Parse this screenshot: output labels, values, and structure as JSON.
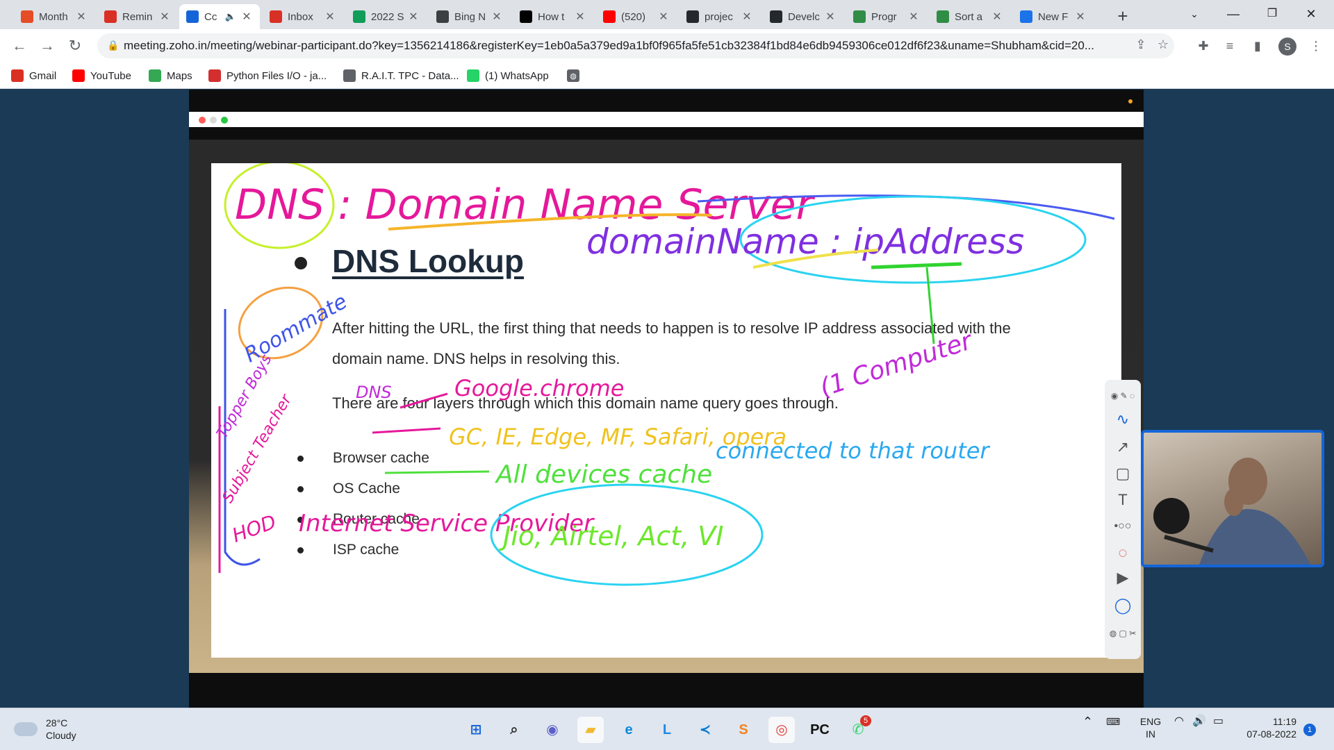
{
  "browser": {
    "tabs": [
      {
        "title": "Month",
        "favicon": "zoho-icon",
        "color": "#e44d26",
        "active": false
      },
      {
        "title": "Remin",
        "favicon": "gmail-icon",
        "color": "#d93025",
        "active": false
      },
      {
        "title": "Cc",
        "favicon": "zoho-meeting-icon",
        "color": "#1565d8",
        "active": true,
        "audio": true
      },
      {
        "title": "Inbox",
        "favicon": "gmail-icon",
        "color": "#d93025",
        "active": false
      },
      {
        "title": "2022 S",
        "favicon": "sheets-icon",
        "color": "#0f9d58",
        "active": false
      },
      {
        "title": "Bing N",
        "favicon": "bing-icon",
        "color": "#3c4043",
        "active": false
      },
      {
        "title": "How t",
        "favicon": "rakuten-icon",
        "color": "#000000",
        "active": false
      },
      {
        "title": "(520)",
        "favicon": "youtube-icon",
        "color": "#ff0000",
        "active": false
      },
      {
        "title": "projec",
        "favicon": "github-icon",
        "color": "#24292e",
        "active": false
      },
      {
        "title": "Develc",
        "favicon": "github-icon",
        "color": "#24292e",
        "active": false
      },
      {
        "title": "Progr",
        "favicon": "gfg-icon",
        "color": "#2f8d46",
        "active": false
      },
      {
        "title": "Sort a",
        "favicon": "gfg-icon",
        "color": "#2f8d46",
        "active": false
      },
      {
        "title": "New F",
        "favicon": "k-icon",
        "color": "#1a73e8",
        "active": false
      }
    ],
    "url": "meeting.zoho.in/meeting/webinar-participant.do?key=1356214186&registerKey=1eb0a5a379ed9a1bf0f965fa5fe51cb32384f1bd84e6db9459306ce012df6f23&uname=Shubham&cid=20...",
    "profile_initial": "S",
    "bookmarks": [
      {
        "label": "Gmail",
        "icon": "gmail-icon",
        "color": "#d93025"
      },
      {
        "label": "YouTube",
        "icon": "youtube-icon",
        "color": "#ff0000"
      },
      {
        "label": "Maps",
        "icon": "maps-icon",
        "color": "#34a853"
      },
      {
        "label": "Python Files I/O - ja...",
        "icon": "javatpoint-icon",
        "color": "#d32f2f"
      },
      {
        "label": "R.A.I.T. TPC - Data...",
        "icon": "globe-icon",
        "color": "#5f6368"
      },
      {
        "label": "(1) WhatsApp",
        "icon": "whatsapp-icon",
        "color": "#25d366"
      }
    ]
  },
  "slide": {
    "title": "DNS Lookup",
    "paragraph1": "After hitting the URL, the first thing that needs to happen is to resolve IP address associated with the domain name. DNS helps in resolving this.",
    "paragraph2": "There are four layers through which this domain name query goes through.",
    "layers": [
      "Browser cache",
      "OS Cache",
      "Router cache",
      "ISP cache"
    ],
    "annotations": {
      "heading": "DNS : Domain Name Server",
      "mapping": "domainName : ipAddress",
      "roommate": "Roommate",
      "dns_label": "DNS",
      "browser_note": "Google.chrome",
      "browsers": "GC, IE, Edge, MF, Safari, opera",
      "one_computer": "(1 Computer",
      "router_note": "All devices cache",
      "connected": "connected to that router",
      "isp_note": "Internet Service Provider",
      "isps": "Jio, Airtel, Act, VI",
      "side_notes": [
        "Topper Boys",
        "Subject Teacher",
        "HOD"
      ]
    }
  },
  "taskbar": {
    "weather_temp": "28°C",
    "weather_desc": "Cloudy",
    "apps": [
      {
        "name": "windows-start-icon",
        "glyph": "⊞",
        "color": "#1565d8"
      },
      {
        "name": "search-icon",
        "glyph": "⌕",
        "color": "#333333"
      },
      {
        "name": "teams-chat-icon",
        "glyph": "◉",
        "color": "#5b5fc7"
      },
      {
        "name": "file-explorer-icon",
        "glyph": "▰",
        "color": "#f2b830"
      },
      {
        "name": "edge-icon",
        "glyph": "e",
        "color": "#0c8ad6"
      },
      {
        "name": "l-app-icon",
        "glyph": "L",
        "color": "#1e88e5"
      },
      {
        "name": "vscode-icon",
        "glyph": "≺",
        "color": "#0078d4"
      },
      {
        "name": "sublime-icon",
        "glyph": "S",
        "color": "#f48120"
      },
      {
        "name": "chrome-icon",
        "glyph": "◎",
        "color": "#e53935"
      },
      {
        "name": "pycharm-icon",
        "glyph": "PC",
        "color": "#111111"
      },
      {
        "name": "whatsapp-icon",
        "glyph": "✆",
        "color": "#25d366"
      }
    ],
    "whatsapp_badge": "5",
    "lang_line1": "ENG",
    "lang_line2": "IN",
    "time": "11:19",
    "date": "07-08-2022",
    "notification_count": "1"
  }
}
